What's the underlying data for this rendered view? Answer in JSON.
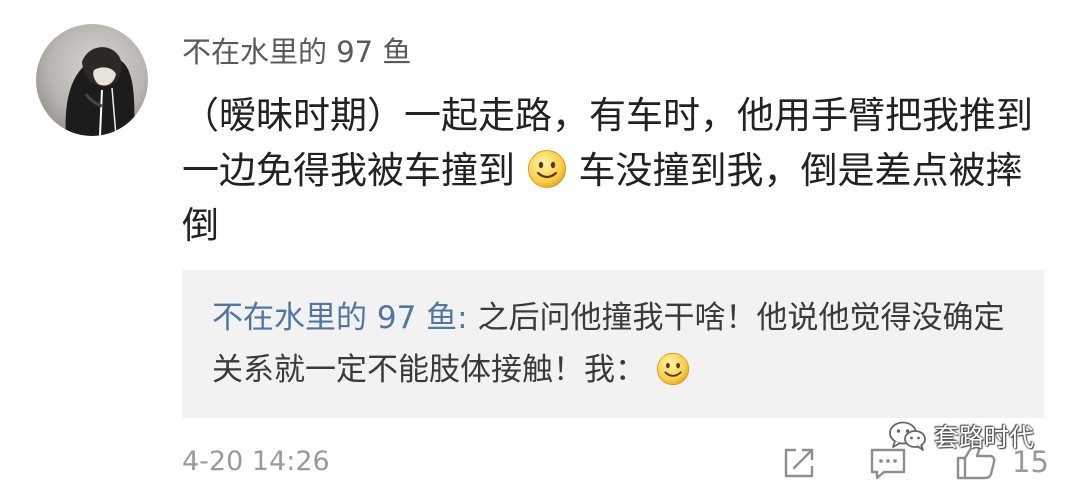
{
  "comment": {
    "username": "不在水里的 97 鱼",
    "text_part1": "（暧昧时期）一起走路，有车时，他用手臂把我推到一边免得我被车撞到",
    "text_part2": "车没撞到我，倒是差点被摔倒",
    "emoji_icon": "smile-emoji-icon",
    "timestamp": "4-20 14:26",
    "like_count": "15"
  },
  "reply": {
    "author": "不在水里的 97 鱼",
    "separator": ": ",
    "text": "之后问他撞我干啥！他说他觉得没确定关系就一定不能肢体接触！我：",
    "emoji_icon": "smile-emoji-icon"
  },
  "actions": {
    "share_icon": "share-icon",
    "comment_icon": "comment-icon",
    "like_icon": "thumbs-up-icon"
  },
  "watermark": {
    "text": "套路时代",
    "icon": "wechat-icon"
  },
  "colors": {
    "username": "#5a5a5a",
    "reply_author": "#52769f",
    "reply_background": "#f2f2f2",
    "timestamp": "#9a9a9a",
    "body_text": "#222222"
  }
}
